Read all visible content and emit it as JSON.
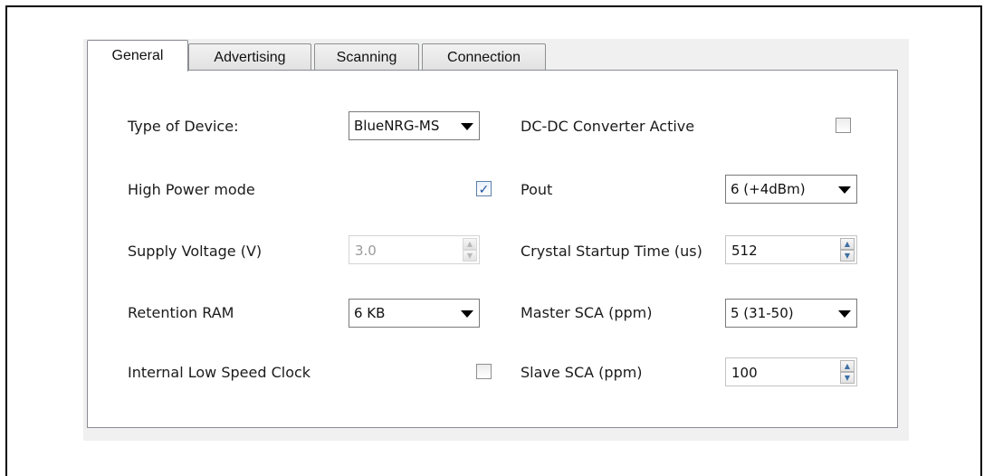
{
  "tabs": [
    "General",
    "Advertising",
    "Scanning",
    "Connection"
  ],
  "left": {
    "type_of_device": {
      "label": "Type of Device:",
      "value": "BlueNRG-MS"
    },
    "high_power_mode": {
      "label": "High Power mode",
      "checked": true
    },
    "supply_voltage": {
      "label": "Supply Voltage (V)",
      "value": "3.0",
      "disabled": true
    },
    "retention_ram": {
      "label": "Retention RAM",
      "value": "6 KB"
    },
    "internal_lsc": {
      "label": "Internal Low Speed Clock",
      "checked": false
    }
  },
  "right": {
    "dcdc": {
      "label": "DC-DC Converter Active",
      "checked": false
    },
    "pout": {
      "label": "Pout",
      "value": "6 (+4dBm)"
    },
    "crystal_startup": {
      "label": "Crystal Startup Time (us)",
      "value": "512"
    },
    "master_sca": {
      "label": "Master SCA (ppm)",
      "value": "5 (31-50)"
    },
    "slave_sca": {
      "label": "Slave SCA (ppm)",
      "value": "100"
    }
  },
  "colors": {
    "checkmark": "#1f4f9c",
    "panel_bg": "#ffffff",
    "window_bg": "#f0f0f0"
  },
  "icons": {
    "checkbox_checked": "check-icon",
    "dropdown": "chevron-down-icon",
    "spinner": "spin-arrows-icon"
  }
}
